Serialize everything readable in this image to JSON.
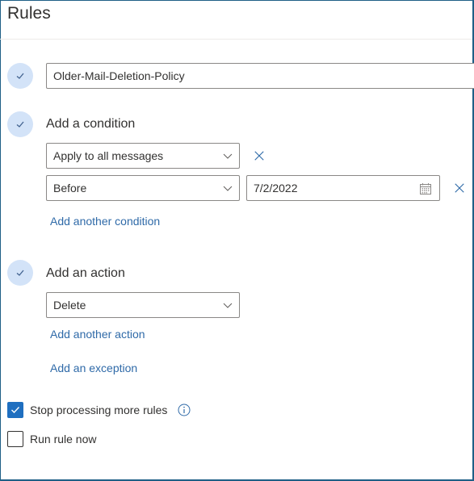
{
  "header": {
    "title": "Rules"
  },
  "rule_name": {
    "value": "Older-Mail-Deletion-Policy"
  },
  "condition": {
    "heading": "Add a condition",
    "primary_select": "Apply to all messages",
    "secondary_select": "Before",
    "date_value": "7/2/2022",
    "add_another_label": "Add another condition"
  },
  "action": {
    "heading": "Add an action",
    "select": "Delete",
    "add_another_label": "Add another action",
    "add_exception_label": "Add an exception"
  },
  "options": {
    "stop_processing": {
      "label": "Stop processing more rules",
      "checked": true
    },
    "run_now": {
      "label": "Run rule now",
      "checked": false
    }
  },
  "icons": {
    "step": "checkmark-icon",
    "dropdown": "chevron-down-icon",
    "remove": "close-icon",
    "date": "calendar-icon",
    "info": "info-icon"
  },
  "colors": {
    "frame_border": "#1e5f86",
    "step_circle": "#d3e3f8",
    "link": "#2f6aa8",
    "checkbox_checked": "#1f6fc0"
  }
}
